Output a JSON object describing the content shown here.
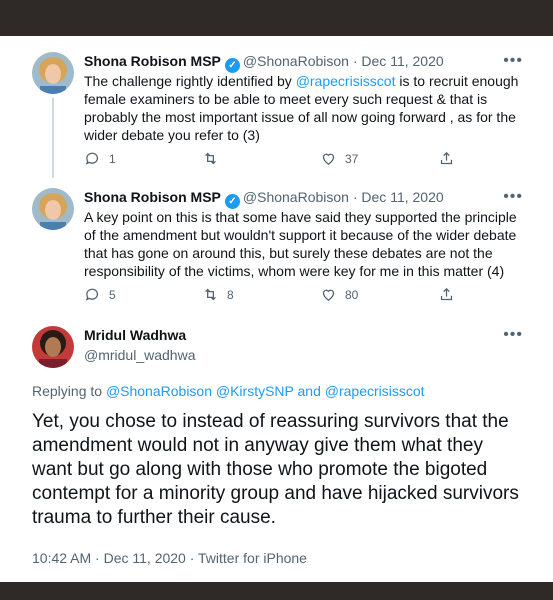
{
  "tweets": [
    {
      "name": "Shona Robison MSP",
      "handle": "@ShonaRobison",
      "date": "Dec 11, 2020",
      "text_a": "The challenge rightly identified by ",
      "mention": "@rapecrisisscot",
      "text_b": " is to recruit enough female examiners to be able to meet every such request & that is probably the most important issue of all now going forward , as for the wider debate you refer to (3)",
      "replies": "1",
      "retweets": "",
      "likes": "37"
    },
    {
      "name": "Shona Robison MSP",
      "handle": "@ShonaRobison",
      "date": "Dec 11, 2020",
      "text": "A key point on this is that some have said they supported the principle of the amendment but wouldn't support it because of the wider debate that has gone on around this, but surely these debates are not the responsibility of the victims, whom were key for me in this matter (4)",
      "replies": "5",
      "retweets": "8",
      "likes": "80"
    }
  ],
  "main": {
    "name": "Mridul Wadhwa",
    "handle": "@mridul_wadhwa",
    "replying_prefix": "Replying to ",
    "replying_to": "@ShonaRobison @KirstySNP and @rapecrisisscot",
    "text": "Yet, you chose to instead of reassuring survivors that the amendment would not in anyway give them what they want but go along with those who promote the bigoted contempt for a minority group and have hijacked survivors trauma to further their cause.",
    "meta": "10:42 AM · Dec 11, 2020 · Twitter for iPhone"
  },
  "ui": {
    "more": "•••",
    "verified": "✓",
    "dot": " · "
  },
  "colors": {
    "link": "#1d9bf0",
    "secondary": "#536471",
    "frame": "#2f2a28"
  }
}
